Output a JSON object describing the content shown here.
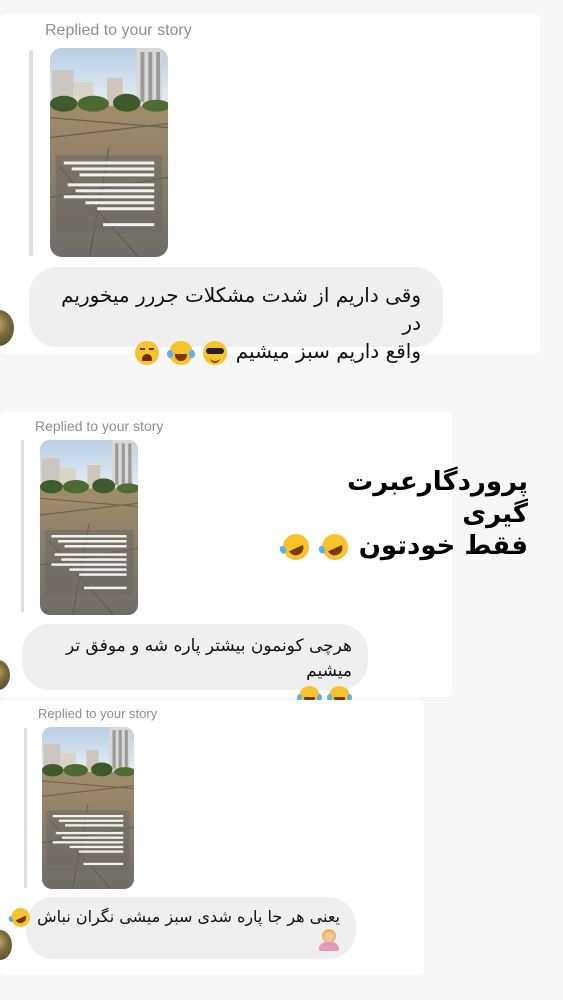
{
  "messages": [
    {
      "replied_label": "Replied to your story",
      "text_line1": "وقی داریم از شدت مشکلات جررر میخوریم در",
      "text_line2": "واقع داریم سبز میشیم",
      "emojis": [
        "weary-face",
        "face-with-tears-of-joy",
        "smiling-face-with-sunglasses"
      ]
    },
    {
      "replied_label": "Replied to your story",
      "text_line1": "هرچی کونمون بیشتر پاره شه و موفق تر میشیم",
      "emojis": [
        "face-with-tears-of-joy",
        "face-with-tears-of-joy"
      ]
    },
    {
      "replied_label": "Replied to your story",
      "text_line1": "یعنی هر جا پاره شدی سبز میشی نگران نباش",
      "emojis": [
        "rolling-on-the-floor-laughing",
        "person-facepalming"
      ]
    }
  ],
  "overlay": {
    "line1": "پروردگارعبرت گیری",
    "line2": "فقط خودتون",
    "emojis": [
      "rolling-on-the-floor-laughing",
      "rolling-on-the-floor-laughing"
    ]
  },
  "colors": {
    "bubble": "#efefef",
    "replied_text": "#8e8e93",
    "reply_line": "#dedede",
    "card": "#ffffff",
    "background": "#f7f7f8"
  }
}
